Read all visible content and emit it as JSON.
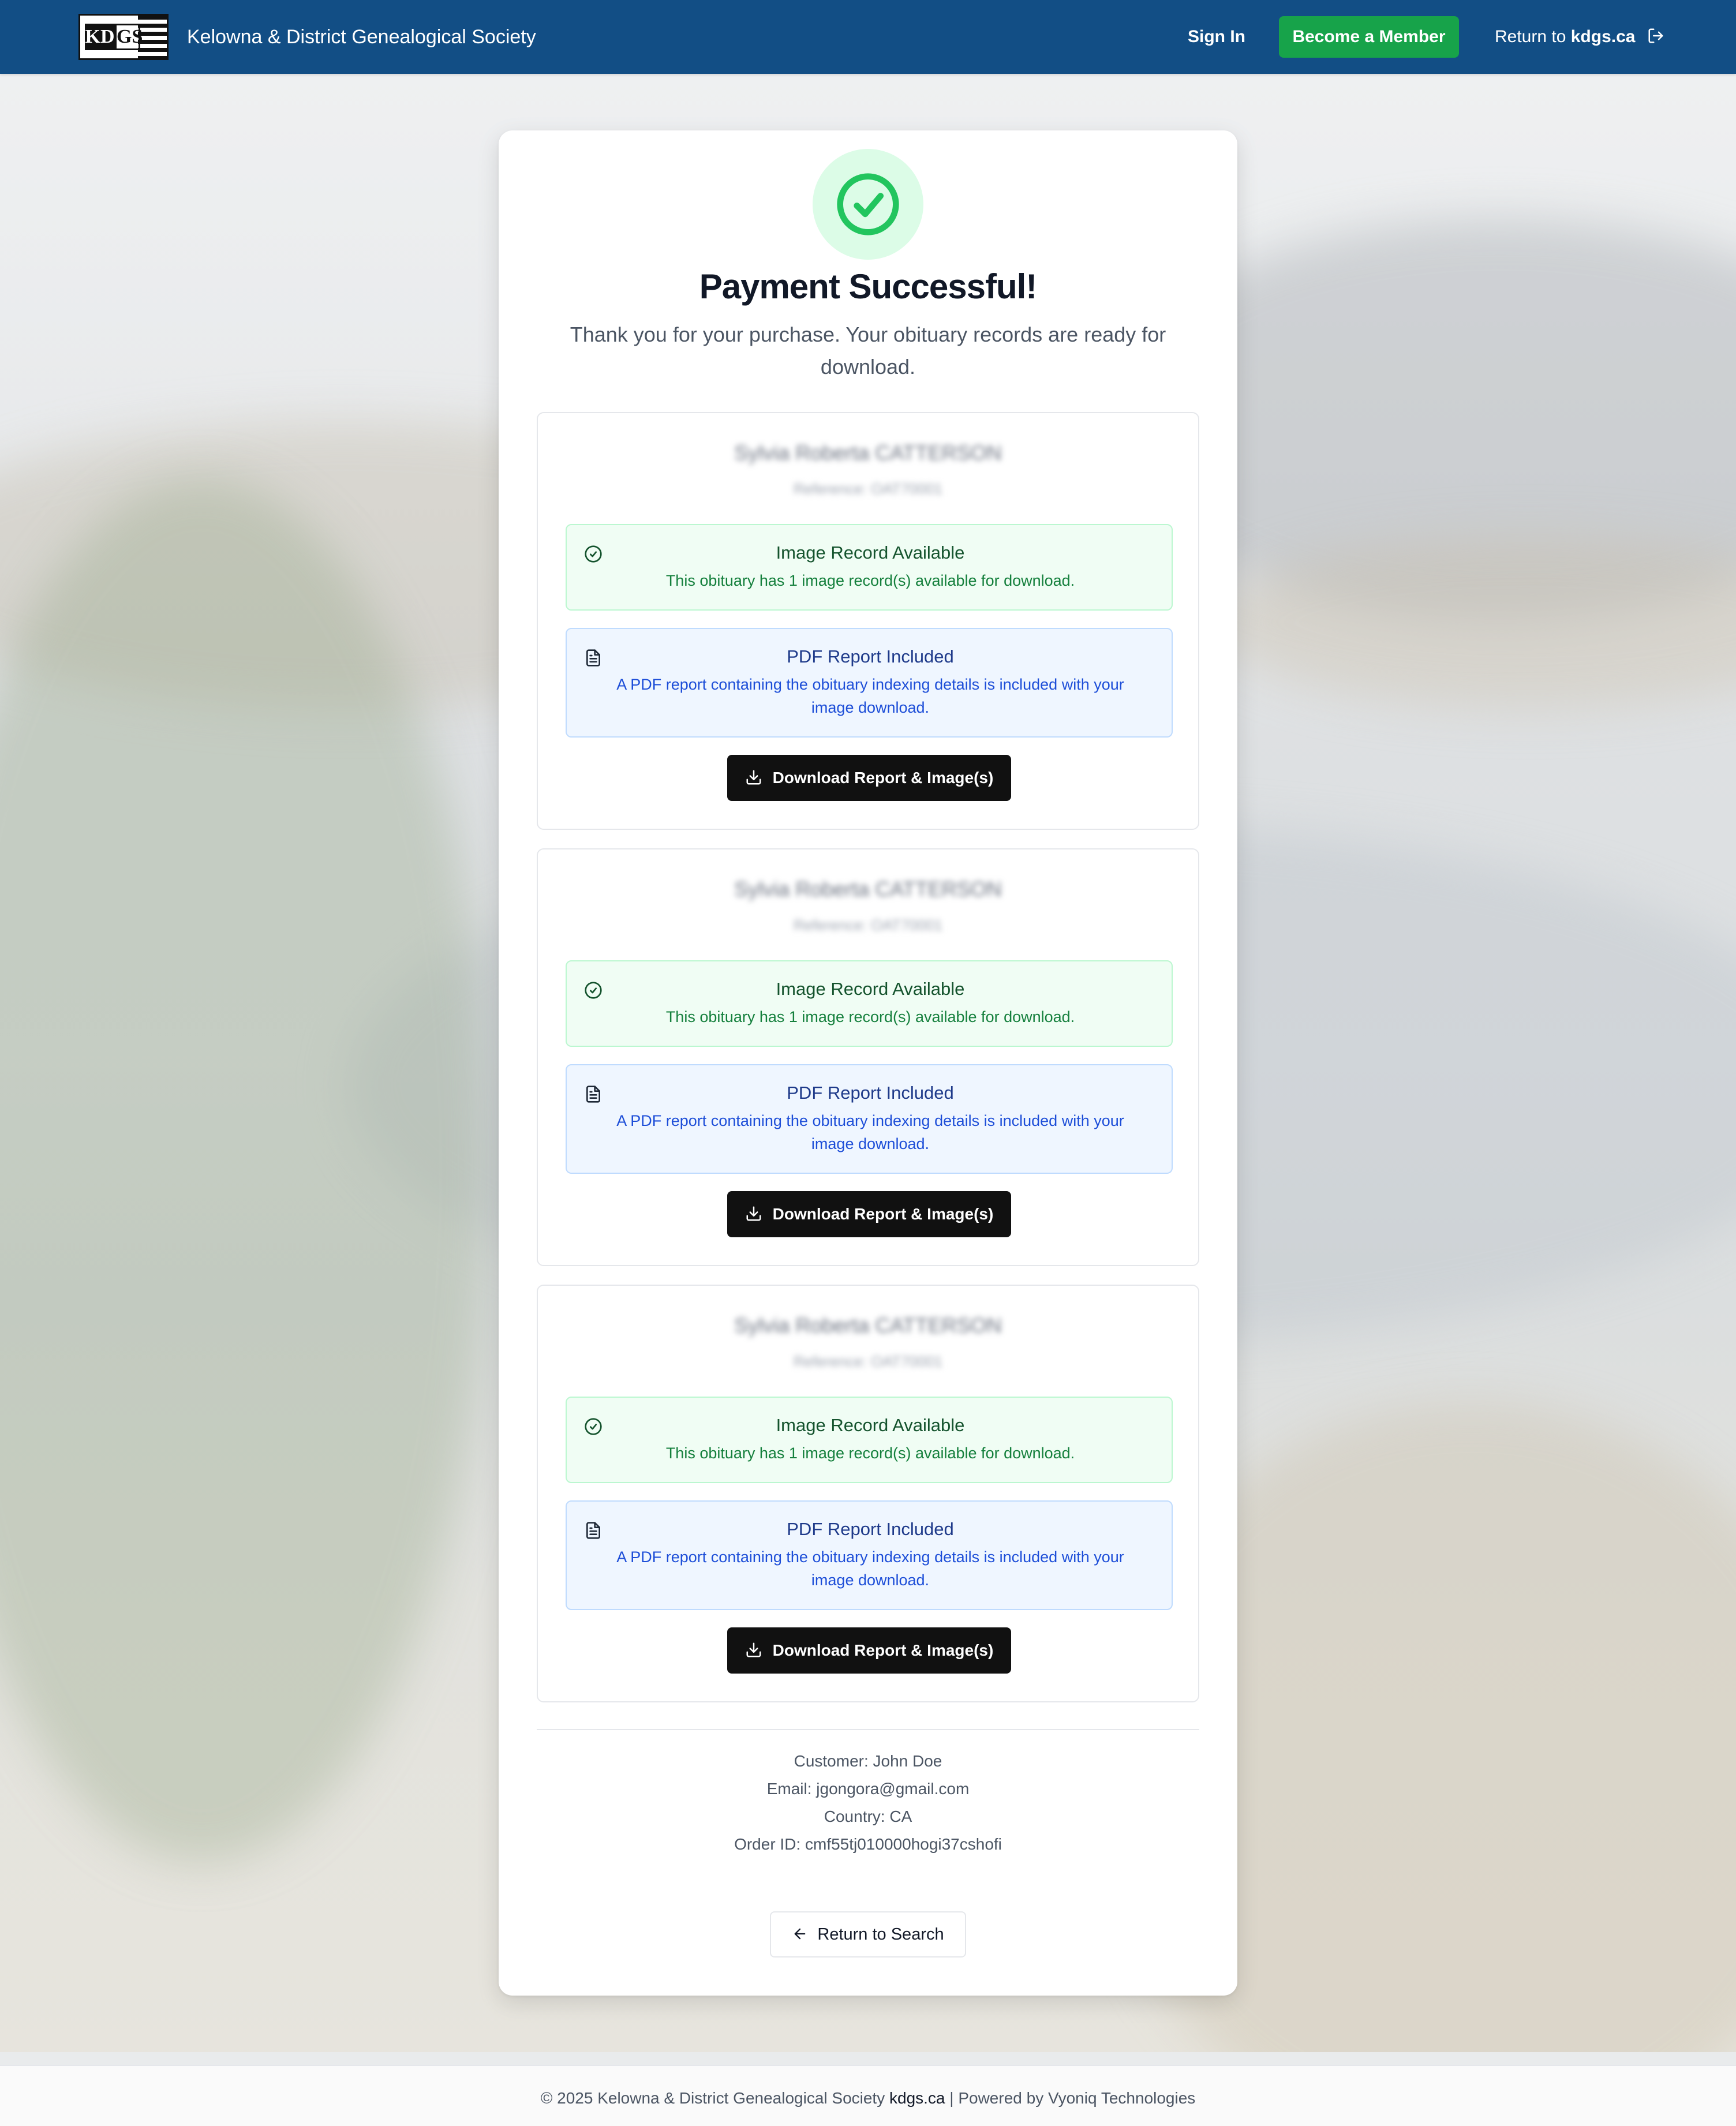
{
  "header": {
    "logo_alt": "KDGS",
    "logo_left": "KD",
    "logo_right": "GS",
    "site_title": "Kelowna & District Genealogical Society",
    "sign_in": "Sign In",
    "become_member": "Become a Member",
    "return_prefix": "Return to ",
    "return_site": "kdgs.ca"
  },
  "colors": {
    "header_bg": "#124e85",
    "member_button": "#17a34a",
    "success_green": "#22c55e",
    "download_button": "#111111"
  },
  "main": {
    "title": "Payment Successful!",
    "subtitle": "Thank you for your purchase. Your obituary records are ready for download.",
    "records": [
      {
        "name": "Sylvia Roberta CATTERSON",
        "reference": "Reference: OAT70001",
        "image_title": "Image Record Available",
        "image_text": "This obituary has 1 image record(s) available for download.",
        "pdf_title": "PDF Report Included",
        "pdf_text": "A PDF report containing the obituary indexing details is included with your image download.",
        "download_label": "Download Report & Image(s)"
      },
      {
        "name": "Sylvia Roberta CATTERSON",
        "reference": "Reference: OAT70001",
        "image_title": "Image Record Available",
        "image_text": "This obituary has 1 image record(s) available for download.",
        "pdf_title": "PDF Report Included",
        "pdf_text": "A PDF report containing the obituary indexing details is included with your image download.",
        "download_label": "Download Report & Image(s)"
      },
      {
        "name": "Sylvia Roberta CATTERSON",
        "reference": "Reference: OAT70001",
        "image_title": "Image Record Available",
        "image_text": "This obituary has 1 image record(s) available for download.",
        "pdf_title": "PDF Report Included",
        "pdf_text": "A PDF report containing the obituary indexing details is included with your image download.",
        "download_label": "Download Report & Image(s)"
      }
    ],
    "customer": "Customer: John Doe",
    "email": "Email: jgongora@gmail.com",
    "country": "Country: CA",
    "order_id": "Order ID: cmf55tj010000hogi37cshofi",
    "return_search": "Return to Search"
  },
  "footer": {
    "copyright": "© 2025 Kelowna & District Genealogical Society ",
    "site": "kdgs.ca",
    "powered": " | Powered by Vyoniq Technologies"
  },
  "icons": [
    "check-circle-icon",
    "circle-check-icon",
    "file-text-icon",
    "download-icon",
    "arrow-left-icon",
    "log-out-icon"
  ]
}
